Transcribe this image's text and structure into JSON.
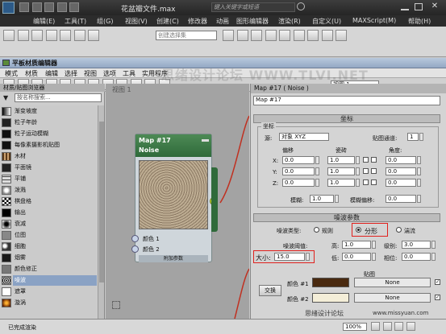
{
  "window": {
    "title": "花盆瓣文件.max",
    "search_placeholder": "键入关键字或短语"
  },
  "menubar": {
    "items": [
      "编辑(E)",
      "工具(T)",
      "组(G)",
      "视图(V)",
      "创建(C)",
      "修改器",
      "动画",
      "图形编辑器",
      "渲染(R)",
      "自定义(U)",
      "MAXScript(M)",
      "帮助(H)"
    ]
  },
  "toolbar": {
    "selection_filter": "创建选择集"
  },
  "watermark": "思绪设计论坛 WWW.TLVI.NET",
  "material_editor": {
    "title": "平板材质编辑器",
    "menu": [
      "模式",
      "材质",
      "编辑",
      "选择",
      "视图",
      "选项",
      "工具",
      "实用程序"
    ],
    "view_select": "视图 1"
  },
  "browser": {
    "title": "材质/贴图浏览器",
    "search_placeholder": "按名称搜索...",
    "items": [
      "渐变坡度",
      "粒子年龄",
      "粒子运动模糊",
      "每像素摄影机贴图",
      "木材",
      "平面镜",
      "平铺",
      "泼溅",
      "棋盘格",
      "输出",
      "衰减",
      "位图",
      "细胞",
      "烟雾",
      "颜色修正",
      "噪波",
      "遮罩",
      "漩涡"
    ],
    "selected": "噪波"
  },
  "view": {
    "title": "视图 1",
    "node_title": "Map #17",
    "node_subtitle": "Noise",
    "node_slots": [
      "颜色 1",
      "颜色 2"
    ],
    "node_footer": "附加参数"
  },
  "panel": {
    "title": "Map #17 ( Noise )",
    "name": "Map #17",
    "coords_rollout": "坐标",
    "coords_group": "坐标",
    "source_label": "源:",
    "source_value": "对象 XYZ",
    "map_channel_label": "贴图通道:",
    "map_channel_value": "1",
    "col_offset": "偏移",
    "col_tiling": "瓷砖",
    "col_angle": "角度:",
    "axes": [
      "X:",
      "Y:",
      "Z:"
    ],
    "values": {
      "offset": "0.0",
      "tiling": "1.0",
      "angle": "0.0"
    },
    "blur_label": "模糊:",
    "blur_value": "1.0",
    "blur_offset_label": "模糊偏移:",
    "blur_offset_value": "0.0",
    "noise_rollout": "噪波参数",
    "noise_type_label": "噪波类型:",
    "noise_types": [
      "规则",
      "分形",
      "湍流"
    ],
    "noise_type_selected": "分形",
    "threshold_label": "噪波阈值:",
    "high_label": "高:",
    "high_value": "1.0",
    "levels_label": "级别:",
    "levels_value": "3.0",
    "low_label": "低:",
    "low_value": "0.0",
    "phase_label": "相位:",
    "phase_value": "0.0",
    "size_label": "大小:",
    "size_value": "15.0",
    "maps_label": "贴图",
    "swap_label": "交换",
    "color1_label": "颜色 #1",
    "color1": "#4a2a10",
    "color2_label": "颜色 #2",
    "color2": "#f4eed8",
    "none_label": "None"
  },
  "status": {
    "text": "已完成渲染",
    "zoom": "100%",
    "forum": "思绪设计论坛",
    "site": "www.missyuan.com"
  }
}
